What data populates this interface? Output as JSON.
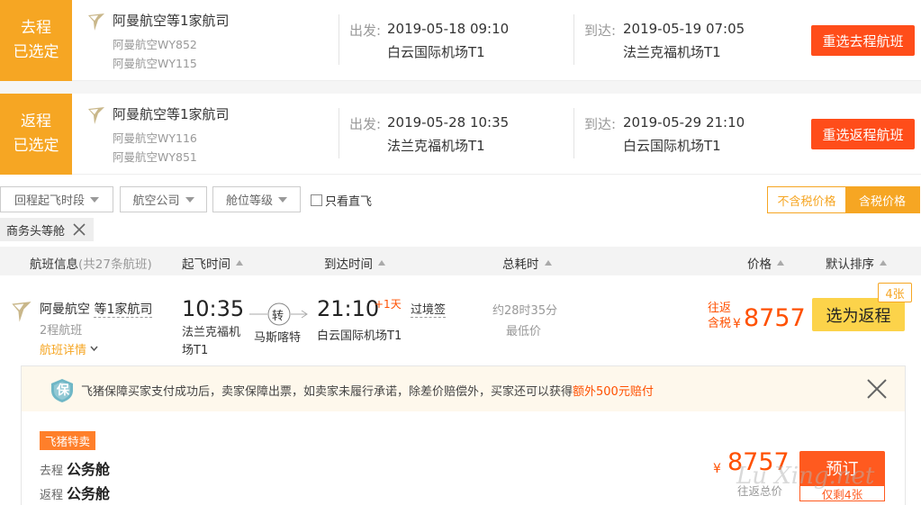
{
  "colors": {
    "accent": "#f6a623",
    "reselect": "#ff4d1a",
    "price": "#ff5000",
    "buy": "#fcd34a"
  },
  "outbound": {
    "badge_top": "去程",
    "badge_bottom": "已选定",
    "airline": "阿曼航空等1家航司",
    "flight_1": "阿曼航空WY852",
    "flight_2": "阿曼航空WY115",
    "depart_label": "出发:",
    "depart_time": "2019-05-18 09:10",
    "depart_airport": "白云国际机场T1",
    "arrive_label": "到达:",
    "arrive_time": "2019-05-19 07:05",
    "arrive_airport": "法兰克福机场T1",
    "reselect_label": "重选去程航班"
  },
  "return": {
    "badge_top": "返程",
    "badge_bottom": "已选定",
    "airline": "阿曼航空等1家航司",
    "flight_1": "阿曼航空WY116",
    "flight_2": "阿曼航空WY851",
    "depart_label": "出发:",
    "depart_time": "2019-05-28 10:35",
    "depart_airport": "法兰克福机场T1",
    "arrive_label": "到达:",
    "arrive_time": "2019-05-29 21:10",
    "arrive_airport": "白云国际机场T1",
    "reselect_label": "重选返程航班"
  },
  "filters": {
    "time_slot": "回程起飞时段",
    "airline": "航空公司",
    "cabin": "舱位等级",
    "direct_only": "只看直飞",
    "tax_excluded": "不含税价格",
    "tax_included": "含税价格",
    "active_tag": "商务头等舱"
  },
  "columns": {
    "info": "航班信息",
    "count": "(共27条航班)",
    "depart": "起飞时间",
    "arrive": "到达时间",
    "duration": "总耗时",
    "price": "价格",
    "sort": "默认排序"
  },
  "result": {
    "airline": "阿曼航空",
    "airline_more": "等1家航司",
    "legs": "2程航班",
    "details_link": "航班详情",
    "depart_time": "10:35",
    "depart_airport": "法兰克福机场T1",
    "transfer": "转",
    "transfer_city": "马斯喀特",
    "arrive_time": "21:10",
    "next_day": "+1天",
    "visa": "过境签",
    "arrive_airport": "白云国际机场T1",
    "duration": "约28时35分",
    "lowest": "最低价",
    "price_type_1": "往返",
    "price_type_2": "含税",
    "currency": "¥",
    "price": "8757",
    "select_label": "选为返程",
    "seats": "4张"
  },
  "detail": {
    "guarantee_icon": "保",
    "guarantee_text": "飞猪保障买家支付成功后，卖家保障出票，如卖家未履行承诺，除差价赔偿外，买家还可以获得",
    "guarantee_highlight": "额外500元赔付",
    "flash_tag": "飞猪特卖",
    "outbound_label": "去程",
    "outbound_cabin": "公务舱",
    "return_label": "返程",
    "return_cabin": "公务舱",
    "currency": "¥",
    "price": "8757",
    "price_note": "往返总价",
    "book_label": "预订",
    "remaining": "仅剩4张",
    "watermark": "Lu Xing.net"
  }
}
